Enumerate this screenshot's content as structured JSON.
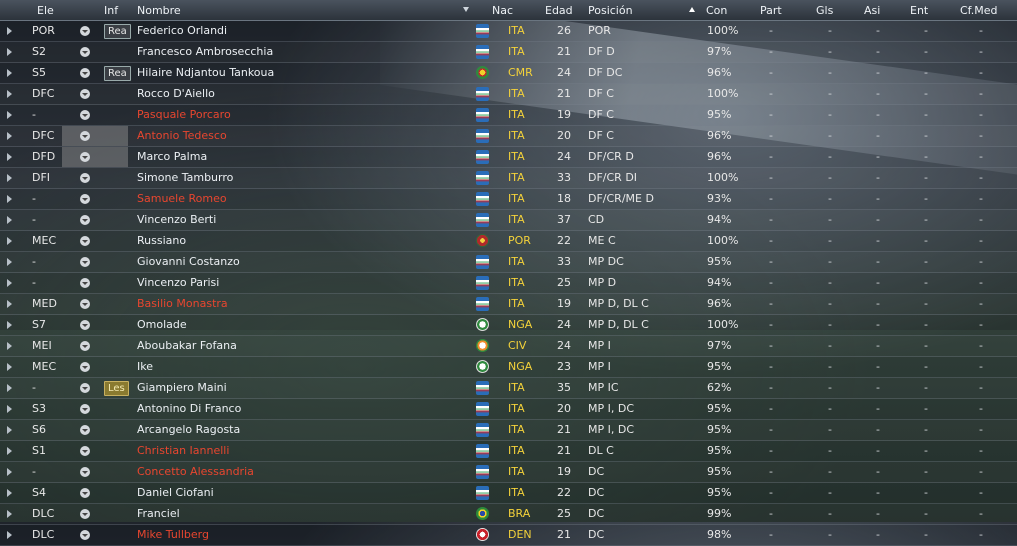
{
  "header": {
    "ele": "Ele",
    "inf": "Inf",
    "nombre": "Nombre",
    "nac": "Nac",
    "edad": "Edad",
    "posicion": "Posición",
    "con": "Con",
    "part": "Part",
    "gls": "Gls",
    "asi": "Asi",
    "ent": "Ent",
    "cfmed": "Cf.Med"
  },
  "colors": {
    "red_name": "#e8462f",
    "nat_text": "#f4d23a",
    "italy_flag": "#2a6db8",
    "cameroon_flag": "#2f8a3e",
    "portugal_flag": "#b02a2a",
    "nigeria_flag": "#2f8a3e",
    "brazil_flag": "#2c8a3a",
    "denmark_flag": "#c8202a"
  },
  "players": [
    {
      "ele": "POR",
      "inf": "Rea",
      "infType": "rea",
      "name": "Federico Orlandi",
      "red": false,
      "flag": "italy",
      "nac": "ITA",
      "age": "26",
      "pos": "POR",
      "con": "100%",
      "part": "-",
      "gls": "-",
      "asi": "-",
      "ent": "-",
      "cf": "-"
    },
    {
      "ele": "S2",
      "inf": "",
      "infType": "",
      "name": "Francesco Ambrosecchia",
      "red": false,
      "flag": "italy",
      "nac": "ITA",
      "age": "21",
      "pos": "DF D",
      "con": "97%",
      "part": "-",
      "gls": "-",
      "asi": "-",
      "ent": "-",
      "cf": "-"
    },
    {
      "ele": "S5",
      "inf": "Rea",
      "infType": "rea",
      "name": "Hilaire Ndjantou Tankoua",
      "red": false,
      "flag": "cameroon",
      "nac": "CMR",
      "age": "24",
      "pos": "DF DC",
      "con": "96%",
      "part": "-",
      "gls": "-",
      "asi": "-",
      "ent": "-",
      "cf": "-"
    },
    {
      "ele": "DFC",
      "inf": "",
      "infType": "",
      "name": "Rocco D'Aiello",
      "red": false,
      "flag": "italy",
      "nac": "ITA",
      "age": "21",
      "pos": "DF C",
      "con": "100%",
      "part": "-",
      "gls": "-",
      "asi": "-",
      "ent": "-",
      "cf": "-"
    },
    {
      "ele": "-",
      "inf": "",
      "infType": "",
      "name": "Pasquale Porcaro",
      "red": true,
      "flag": "italy",
      "nac": "ITA",
      "age": "19",
      "pos": "DF C",
      "con": "95%",
      "part": "-",
      "gls": "-",
      "asi": "-",
      "ent": "-",
      "cf": "-"
    },
    {
      "ele": "DFC",
      "inf": "",
      "infType": "",
      "name": "Antonio Tedesco",
      "red": true,
      "flag": "italy",
      "nac": "ITA",
      "age": "20",
      "pos": "DF C",
      "con": "96%",
      "part": "-",
      "gls": "-",
      "asi": "-",
      "ent": "-",
      "cf": "-"
    },
    {
      "ele": "DFD",
      "inf": "",
      "infType": "",
      "name": "Marco Palma",
      "red": false,
      "flag": "italy",
      "nac": "ITA",
      "age": "24",
      "pos": "DF/CR D",
      "con": "96%",
      "part": "-",
      "gls": "-",
      "asi": "-",
      "ent": "-",
      "cf": "-"
    },
    {
      "ele": "DFI",
      "inf": "",
      "infType": "",
      "name": "Simone Tamburro",
      "red": false,
      "flag": "italy",
      "nac": "ITA",
      "age": "33",
      "pos": "DF/CR DI",
      "con": "100%",
      "part": "-",
      "gls": "-",
      "asi": "-",
      "ent": "-",
      "cf": "-"
    },
    {
      "ele": "-",
      "inf": "",
      "infType": "",
      "name": "Samuele Romeo",
      "red": true,
      "flag": "italy",
      "nac": "ITA",
      "age": "18",
      "pos": "DF/CR/ME D",
      "con": "93%",
      "part": "-",
      "gls": "-",
      "asi": "-",
      "ent": "-",
      "cf": "-"
    },
    {
      "ele": "-",
      "inf": "",
      "infType": "",
      "name": "Vincenzo Berti",
      "red": false,
      "flag": "italy",
      "nac": "ITA",
      "age": "37",
      "pos": "CD",
      "con": "94%",
      "part": "-",
      "gls": "-",
      "asi": "-",
      "ent": "-",
      "cf": "-"
    },
    {
      "ele": "MEC",
      "inf": "",
      "infType": "",
      "name": "Russiano",
      "red": false,
      "flag": "portugal",
      "nac": "POR",
      "age": "22",
      "pos": "ME C",
      "con": "100%",
      "part": "-",
      "gls": "-",
      "asi": "-",
      "ent": "-",
      "cf": "-"
    },
    {
      "ele": "-",
      "inf": "",
      "infType": "",
      "name": "Giovanni Costanzo",
      "red": false,
      "flag": "italy",
      "nac": "ITA",
      "age": "33",
      "pos": "MP DC",
      "con": "95%",
      "part": "-",
      "gls": "-",
      "asi": "-",
      "ent": "-",
      "cf": "-"
    },
    {
      "ele": "-",
      "inf": "",
      "infType": "",
      "name": "Vincenzo Parisi",
      "red": false,
      "flag": "italy",
      "nac": "ITA",
      "age": "25",
      "pos": "MP D",
      "con": "94%",
      "part": "-",
      "gls": "-",
      "asi": "-",
      "ent": "-",
      "cf": "-"
    },
    {
      "ele": "MED",
      "inf": "",
      "infType": "",
      "name": "Basilio Monastra",
      "red": true,
      "flag": "italy",
      "nac": "ITA",
      "age": "19",
      "pos": "MP D, DL C",
      "con": "96%",
      "part": "-",
      "gls": "-",
      "asi": "-",
      "ent": "-",
      "cf": "-"
    },
    {
      "ele": "S7",
      "inf": "",
      "infType": "",
      "name": "Omolade",
      "red": false,
      "flag": "nigeria",
      "nac": "NGA",
      "age": "24",
      "pos": "MP D, DL C",
      "con": "100%",
      "part": "-",
      "gls": "-",
      "asi": "-",
      "ent": "-",
      "cf": "-"
    },
    {
      "ele": "MEI",
      "inf": "",
      "infType": "",
      "name": "Aboubakar Fofana",
      "red": false,
      "flag": "ivorycoast",
      "nac": "CIV",
      "age": "24",
      "pos": "MP I",
      "con": "97%",
      "part": "-",
      "gls": "-",
      "asi": "-",
      "ent": "-",
      "cf": "-"
    },
    {
      "ele": "MEC",
      "inf": "",
      "infType": "",
      "name": "Ike",
      "red": false,
      "flag": "nigeria",
      "nac": "NGA",
      "age": "23",
      "pos": "MP I",
      "con": "95%",
      "part": "-",
      "gls": "-",
      "asi": "-",
      "ent": "-",
      "cf": "-"
    },
    {
      "ele": "-",
      "inf": "Les",
      "infType": "les",
      "name": "Giampiero Maini",
      "red": false,
      "flag": "italy",
      "nac": "ITA",
      "age": "35",
      "pos": "MP IC",
      "con": "62%",
      "part": "-",
      "gls": "-",
      "asi": "-",
      "ent": "-",
      "cf": "-"
    },
    {
      "ele": "S3",
      "inf": "",
      "infType": "",
      "name": "Antonino Di Franco",
      "red": false,
      "flag": "italy",
      "nac": "ITA",
      "age": "20",
      "pos": "MP I, DC",
      "con": "95%",
      "part": "-",
      "gls": "-",
      "asi": "-",
      "ent": "-",
      "cf": "-"
    },
    {
      "ele": "S6",
      "inf": "",
      "infType": "",
      "name": "Arcangelo Ragosta",
      "red": false,
      "flag": "italy",
      "nac": "ITA",
      "age": "21",
      "pos": "MP I, DC",
      "con": "95%",
      "part": "-",
      "gls": "-",
      "asi": "-",
      "ent": "-",
      "cf": "-"
    },
    {
      "ele": "S1",
      "inf": "",
      "infType": "",
      "name": "Christian Iannelli",
      "red": true,
      "flag": "italy",
      "nac": "ITA",
      "age": "21",
      "pos": "DL C",
      "con": "95%",
      "part": "-",
      "gls": "-",
      "asi": "-",
      "ent": "-",
      "cf": "-"
    },
    {
      "ele": "-",
      "inf": "",
      "infType": "",
      "name": "Concetto Alessandria",
      "red": true,
      "flag": "italy",
      "nac": "ITA",
      "age": "19",
      "pos": "DC",
      "con": "95%",
      "part": "-",
      "gls": "-",
      "asi": "-",
      "ent": "-",
      "cf": "-"
    },
    {
      "ele": "S4",
      "inf": "",
      "infType": "",
      "name": "Daniel Ciofani",
      "red": false,
      "flag": "italy",
      "nac": "ITA",
      "age": "22",
      "pos": "DC",
      "con": "95%",
      "part": "-",
      "gls": "-",
      "asi": "-",
      "ent": "-",
      "cf": "-"
    },
    {
      "ele": "DLC",
      "inf": "",
      "infType": "",
      "name": "Franciel",
      "red": false,
      "flag": "brazil",
      "nac": "BRA",
      "age": "25",
      "pos": "DC",
      "con": "99%",
      "part": "-",
      "gls": "-",
      "asi": "-",
      "ent": "-",
      "cf": "-"
    },
    {
      "ele": "DLC",
      "inf": "",
      "infType": "",
      "name": "Mike Tullberg",
      "red": true,
      "flag": "denmark",
      "nac": "DEN",
      "age": "21",
      "pos": "DC",
      "con": "98%",
      "part": "-",
      "gls": "-",
      "asi": "-",
      "ent": "-",
      "cf": "-"
    }
  ]
}
